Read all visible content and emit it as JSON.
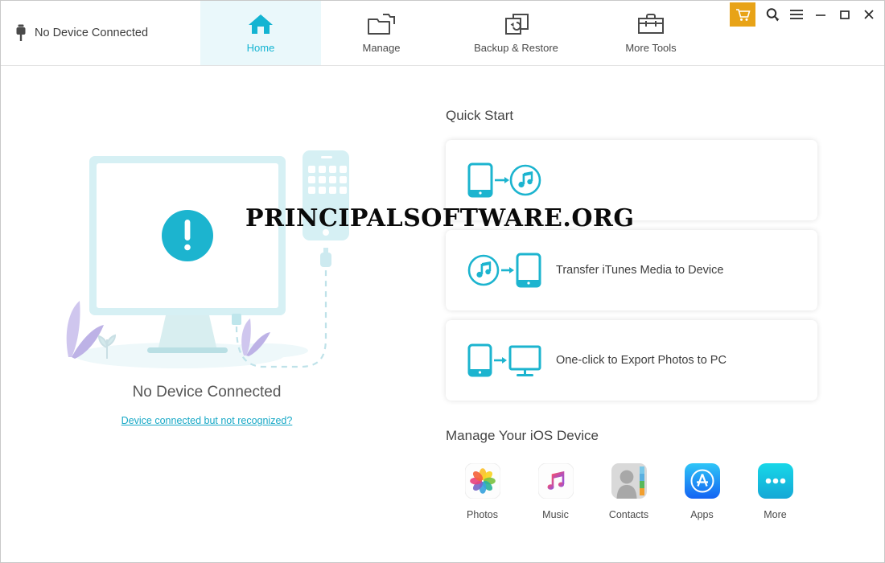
{
  "window": {
    "device_status": "No Device Connected",
    "plug_icon": "lightning-connector-icon",
    "controls": {
      "cart": "shopping-cart-icon",
      "search": "search-icon",
      "menu": "hamburger-menu-icon",
      "minimize": "minimize-icon",
      "maximize": "maximize-icon",
      "close": "close-icon"
    }
  },
  "tabs": [
    {
      "id": "home",
      "label": "Home",
      "icon": "home-icon",
      "active": true
    },
    {
      "id": "manage",
      "label": "Manage",
      "icon": "folders-icon",
      "active": false
    },
    {
      "id": "backup",
      "label": "Backup & Restore",
      "icon": "backup-restore-icon",
      "active": false
    },
    {
      "id": "tools",
      "label": "More Tools",
      "icon": "toolbox-icon",
      "active": false
    }
  ],
  "left": {
    "illustration": "disconnected-device-illustration",
    "no_device_title": "No Device Connected",
    "not_recognized_link": "Device connected but not recognized?"
  },
  "quick_start": {
    "title": "Quick Start",
    "cards": [
      {
        "label": "",
        "icon": "device-to-itunes-icon",
        "obscured_by_watermark": true
      },
      {
        "label": "Transfer iTunes Media to Device",
        "icon": "itunes-to-device-icon"
      },
      {
        "label": "One-click to Export Photos to PC",
        "icon": "device-to-pc-icon"
      }
    ]
  },
  "manage_device": {
    "title": "Manage Your iOS Device",
    "items": [
      {
        "label": "Photos",
        "icon": "photos-app-icon"
      },
      {
        "label": "Music",
        "icon": "music-app-icon"
      },
      {
        "label": "Contacts",
        "icon": "contacts-app-icon"
      },
      {
        "label": "Apps",
        "icon": "appstore-app-icon"
      },
      {
        "label": "More",
        "icon": "more-dots-icon"
      }
    ]
  },
  "watermark": {
    "text": "PRINCIPALSOFTWARE.ORG"
  },
  "colors": {
    "accent": "#14b4d2",
    "accent_light": "#eaf8fb",
    "cart_orange": "#e8a317",
    "link": "#17a8c6",
    "text": "#3d3d3d"
  }
}
